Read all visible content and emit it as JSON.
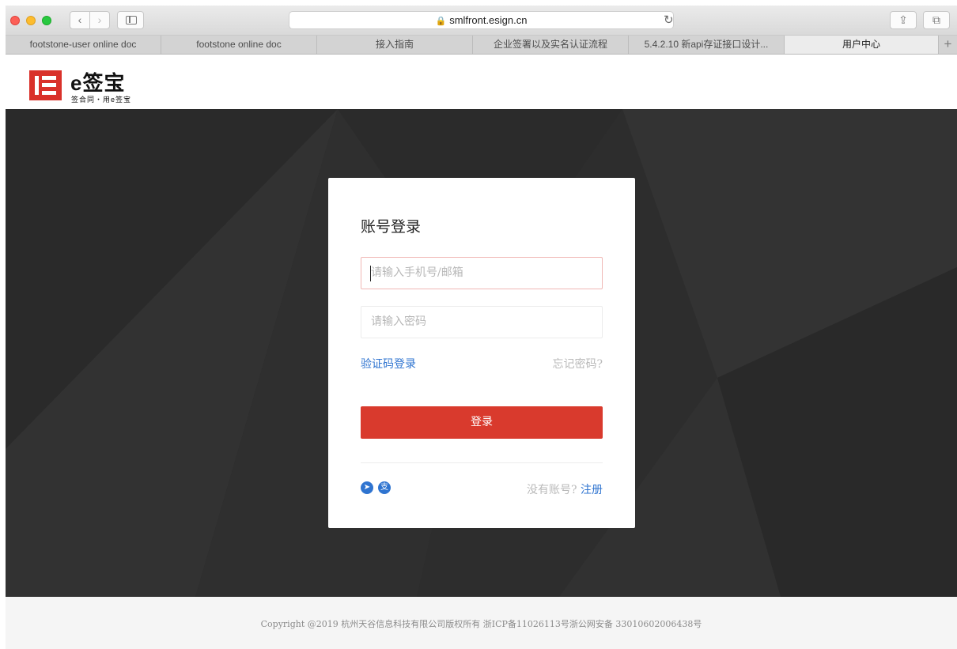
{
  "browser": {
    "url": "smlfront.esign.cn",
    "tabs": [
      {
        "label": "footstone-user online doc",
        "active": false
      },
      {
        "label": "footstone online doc",
        "active": false
      },
      {
        "label": "接入指南",
        "active": false
      },
      {
        "label": "企业签署以及实名认证流程",
        "active": false
      },
      {
        "label": "5.4.2.10 新api存证接口设计...",
        "active": false
      },
      {
        "label": "用户中心",
        "active": true
      }
    ],
    "new_tab_label": "+",
    "back_icon": "‹",
    "forward_icon": "›",
    "reload_icon": "↻",
    "share_icon": "⇪",
    "tabs_icon": "⧉"
  },
  "site": {
    "logo_text": "e签宝",
    "logo_sub": "签合同・用e签宝"
  },
  "login": {
    "title": "账号登录",
    "username_placeholder": "请输入手机号/邮箱",
    "password_placeholder": "请输入密码",
    "sms_login": "验证码登录",
    "forgot_password": "忘记密码?",
    "login_button": "登录",
    "no_account": "没有账号?",
    "register": "注册",
    "social_icons": [
      "dingtalk-icon",
      "alipay-icon"
    ]
  },
  "footer": {
    "copyright": "Copyright @2019 杭州天谷信息科技有限公司版权所有 浙ICP备11026113号浙公网安备 33010602006438号"
  },
  "colors": {
    "brand_red": "#d93a2d",
    "link_blue": "#2f74d0",
    "hero_dark": "#2d2d2d"
  }
}
